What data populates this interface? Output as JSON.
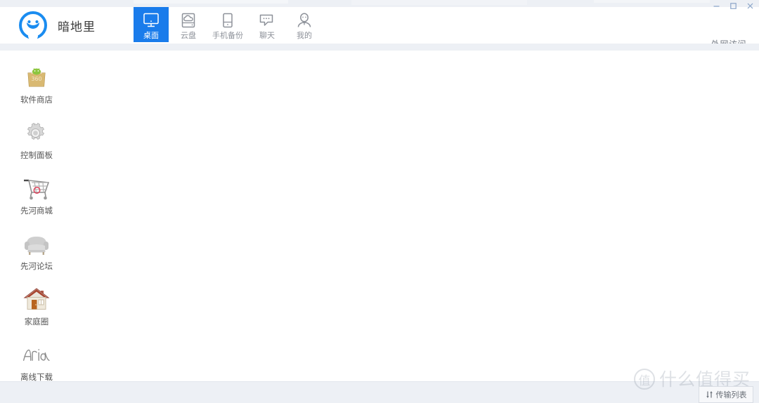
{
  "window": {
    "controls": [
      {
        "name": "minimize",
        "glyph": "minimize-icon"
      },
      {
        "name": "maximize",
        "glyph": "maximize-icon"
      },
      {
        "name": "close",
        "glyph": "close-icon"
      }
    ]
  },
  "header": {
    "brand_title": "暗地里",
    "logo_icon": "smiley-circle-logo",
    "external_access_label": "外网访问",
    "accent_color": "#1a7ceb",
    "tabs": [
      {
        "label": "桌面",
        "icon": "monitor-icon",
        "active": true
      },
      {
        "label": "云盘",
        "icon": "cloud-drive-icon",
        "active": false
      },
      {
        "label": "手机备份",
        "icon": "phone-backup-icon",
        "active": false
      },
      {
        "label": "聊天",
        "icon": "chat-bubble-icon",
        "active": false
      },
      {
        "label": "我的",
        "icon": "user-profile-icon",
        "active": false
      }
    ]
  },
  "desktop": {
    "icons": [
      {
        "label": "软件商店",
        "icon": "app-store-bag-icon"
      },
      {
        "label": "控制面板",
        "icon": "gear-icon"
      },
      {
        "label": "先河商城",
        "icon": "shopping-cart-icon"
      },
      {
        "label": "先河论坛",
        "icon": "sofa-icon"
      },
      {
        "label": "家庭圈",
        "icon": "house-icon"
      },
      {
        "label": "离线下载",
        "icon": "aria-logo-icon"
      }
    ]
  },
  "bottom_bar": {
    "transfer_button_label": "传输列表",
    "transfer_button_icon": "transfer-arrows-icon"
  },
  "watermark": {
    "badge_text": "值",
    "text": "什么值得买"
  }
}
